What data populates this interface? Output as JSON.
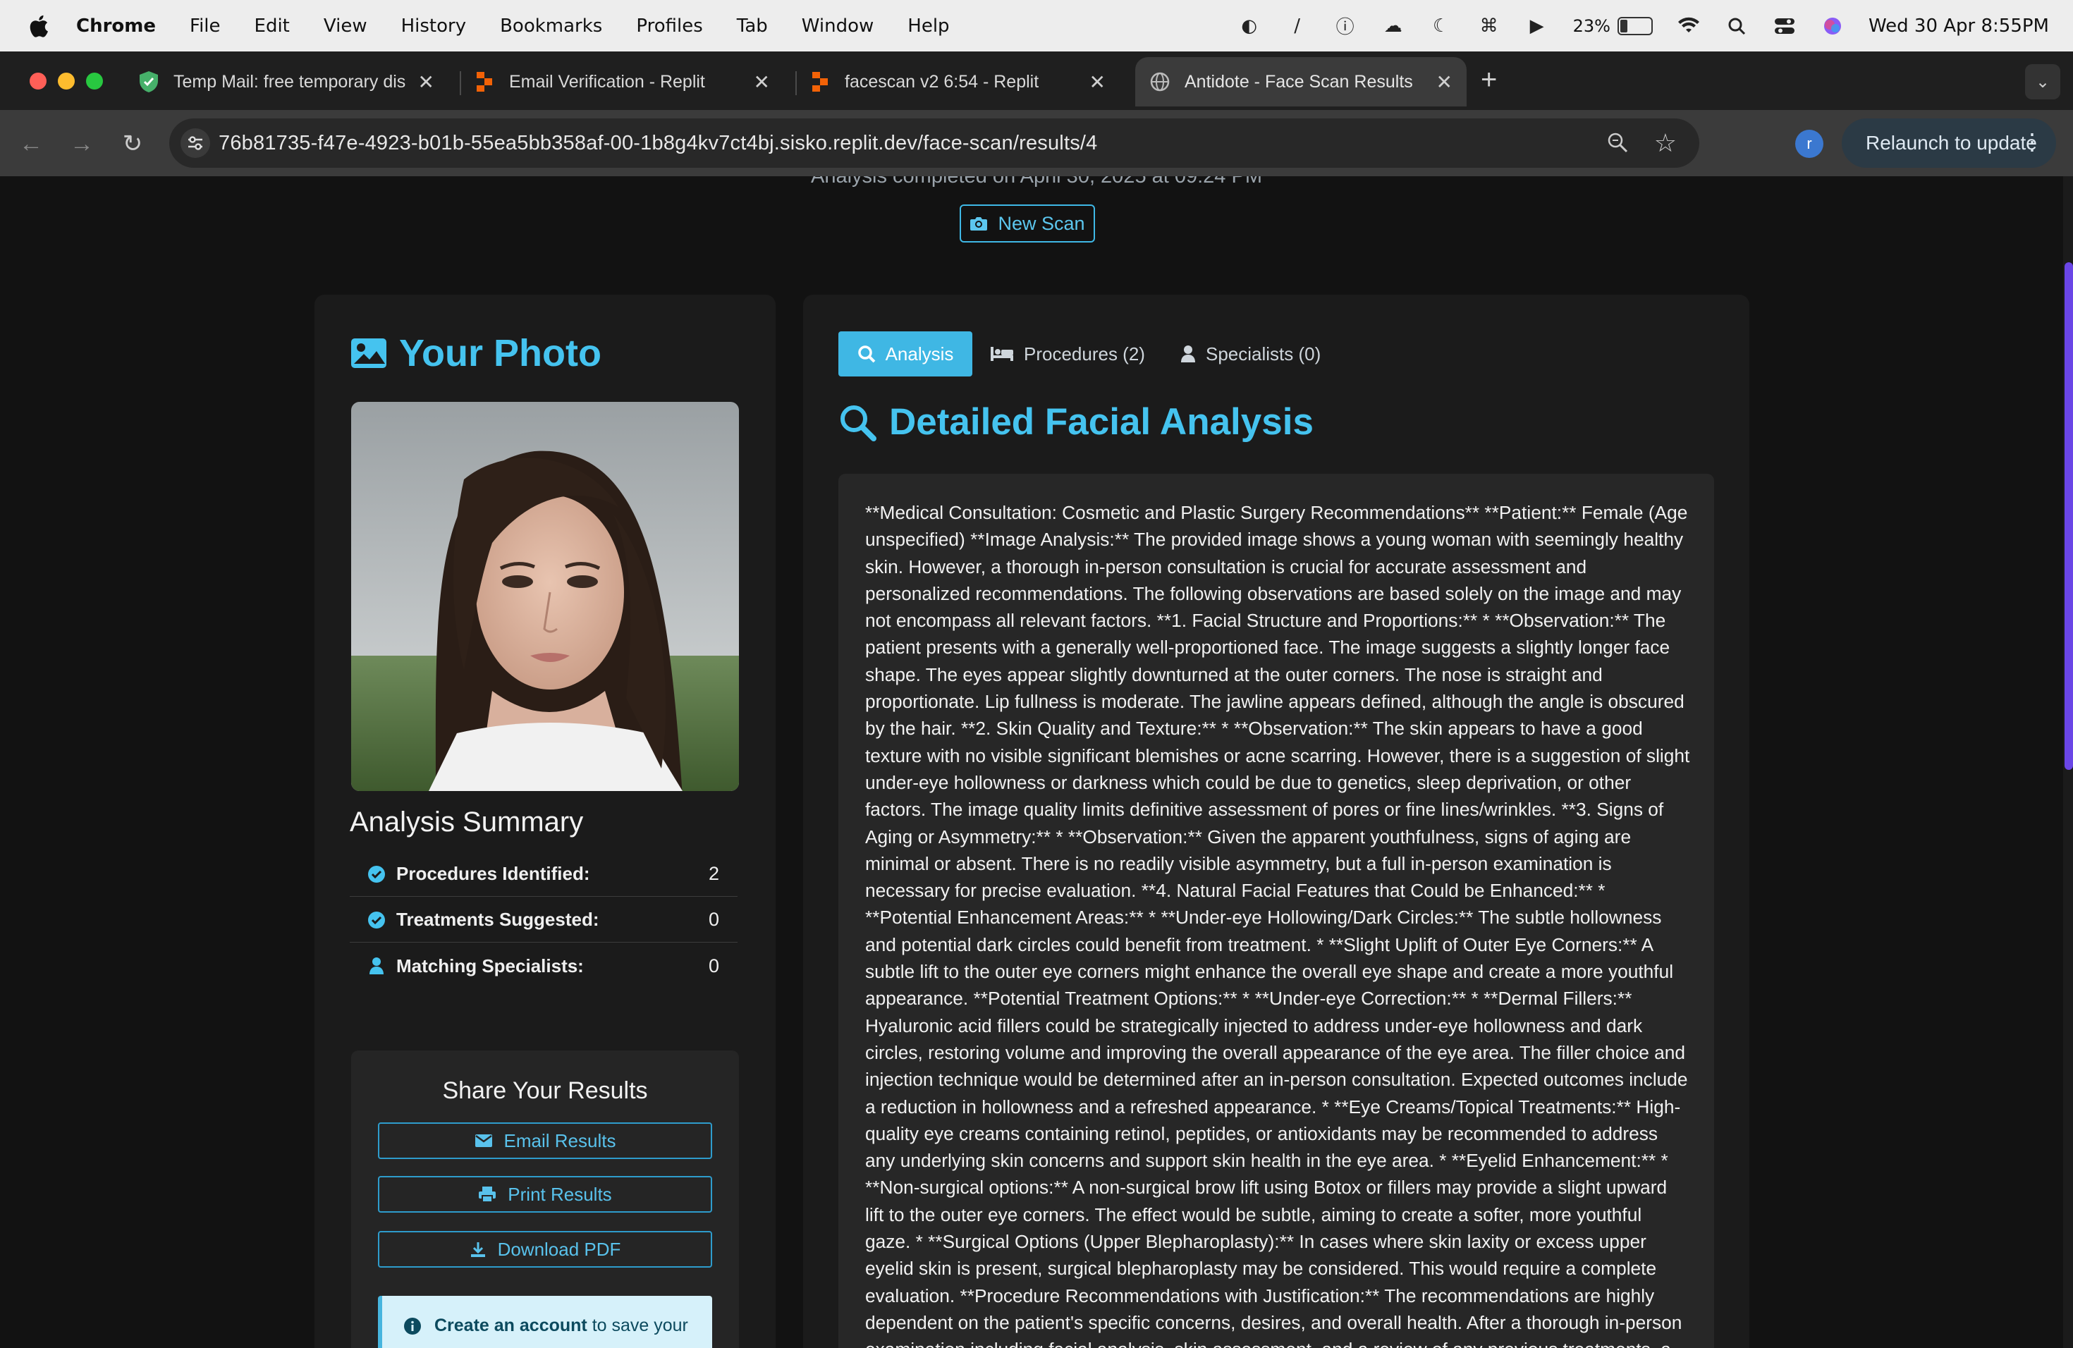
{
  "menubar": {
    "items": [
      "Chrome",
      "File",
      "Edit",
      "View",
      "History",
      "Bookmarks",
      "Profiles",
      "Tab",
      "Window",
      "Help"
    ],
    "battery": "23%",
    "datetime": "Wed 30 Apr  8:55PM"
  },
  "browser": {
    "tabs": [
      {
        "title": "Temp Mail: free temporary dis",
        "icon": "shield-check-icon"
      },
      {
        "title": "Email Verification - Replit",
        "icon": "replit-icon"
      },
      {
        "title": "facescan v2 6:54 - Replit",
        "icon": "replit-icon"
      },
      {
        "title": "Antidote - Face Scan Results",
        "icon": "globe-icon"
      }
    ],
    "url": "76b81735-f47e-4923-b01b-55ea5bb358af-00-1b8g4kv7ct4bj.sisko.replit.dev/face-scan/results/4",
    "profile_initial": "r",
    "relaunch_label": "Relaunch to update"
  },
  "page": {
    "completed_text": "Analysis completed on April 30, 2025 at 09:24 PM",
    "new_scan_label": "New Scan",
    "photo_heading": "Your Photo",
    "summary": {
      "title": "Analysis Summary",
      "rows": [
        {
          "label": "Procedures Identified:",
          "value": "2"
        },
        {
          "label": "Treatments Suggested:",
          "value": "0"
        },
        {
          "label": "Matching Specialists:",
          "value": "0"
        }
      ]
    },
    "share": {
      "title": "Share Your Results",
      "email_label": "Email Results",
      "print_label": "Print Results",
      "pdf_label": "Download PDF",
      "info_bold": "Create an account",
      "info_rest": " to save your"
    },
    "tabs": {
      "analysis": "Analysis",
      "procedures": "Procedures (2)",
      "specialists": "Specialists (0)"
    },
    "analysis_heading": "Detailed Facial Analysis",
    "analysis_text": "**Medical Consultation: Cosmetic and Plastic Surgery Recommendations** **Patient:** Female (Age unspecified) **Image Analysis:** The provided image shows a young woman with seemingly healthy skin. However, a thorough in-person consultation is crucial for accurate assessment and personalized recommendations. The following observations are based solely on the image and may not encompass all relevant factors. **1. Facial Structure and Proportions:** * **Observation:** The patient presents with a generally well-proportioned face. The image suggests a slightly longer face shape. The eyes appear slightly downturned at the outer corners. The nose is straight and proportionate. Lip fullness is moderate. The jawline appears defined, although the angle is obscured by the hair. **2. Skin Quality and Texture:** * **Observation:** The skin appears to have a good texture with no visible significant blemishes or acne scarring. However, there is a suggestion of slight under-eye hollowness or darkness which could be due to genetics, sleep deprivation, or other factors. The image quality limits definitive assessment of pores or fine lines/wrinkles. **3. Signs of Aging or Asymmetry:** * **Observation:** Given the apparent youthfulness, signs of aging are minimal or absent. There is no readily visible asymmetry, but a full in-person examination is necessary for precise evaluation. **4. Natural Facial Features that Could be Enhanced:** * **Potential Enhancement Areas:** * **Under-eye Hollowing/Dark Circles:** The subtle hollowness and potential dark circles could benefit from treatment. * **Slight Uplift of Outer Eye Corners:** A subtle lift to the outer eye corners might enhance the overall eye shape and create a more youthful appearance. **Potential Treatment Options:** * **Under-eye Correction:** * **Dermal Fillers:** Hyaluronic acid fillers could be strategically injected to address under-eye hollowness and dark circles, restoring volume and improving the overall appearance of the eye area. The filler choice and injection technique would be determined after an in-person consultation. Expected outcomes include a reduction in hollowness and a refreshed appearance. * **Eye Creams/Topical Treatments:** High-quality eye creams containing retinol, peptides, or antioxidants may be recommended to address any underlying skin concerns and support skin health in the eye area. * **Eyelid Enhancement:** * **Non-surgical options:** A non-surgical brow lift using Botox or fillers may provide a slight upward lift to the outer eye corners. The effect would be subtle, aiming to create a softer, more youthful gaze. * **Surgical Options (Upper Blepharoplasty):** In cases where skin laxity or excess upper eyelid skin is present, surgical blepharoplasty may be considered. This would require a complete evaluation. **Procedure Recommendations with Justification:** The recommendations are highly dependent on the patient's specific concerns, desires, and overall health. After a thorough in-person examination including facial analysis, skin assessment, and a review of any previous treatments, a tailored treatment plan can be developed."
  },
  "colors": {
    "accent": "#45c3ef",
    "scrollbar": "#6a46e6"
  }
}
